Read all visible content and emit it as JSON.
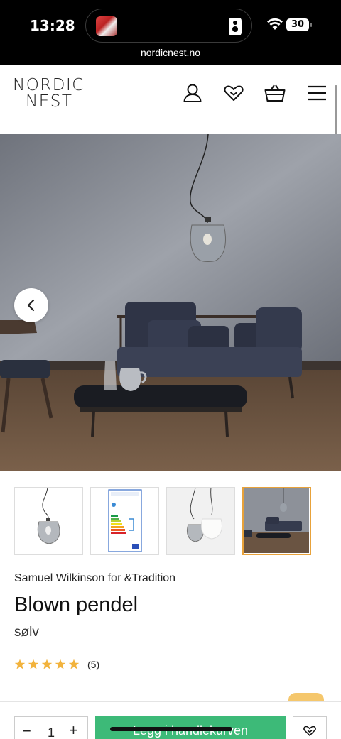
{
  "status_bar": {
    "time": "13:28",
    "battery": "30",
    "url": "nordicnest.no"
  },
  "header": {
    "logo_line1": "NORDIC",
    "logo_line2": "NEST",
    "icons": [
      "account-icon",
      "wishlist-heart-icon",
      "cart-basket-icon",
      "menu-icon"
    ]
  },
  "gallery": {
    "thumbnails": [
      {
        "name": "thumb-lamp",
        "active": false
      },
      {
        "name": "thumb-energy-label",
        "active": false
      },
      {
        "name": "thumb-lamp-pair",
        "active": false
      },
      {
        "name": "thumb-room",
        "active": true
      }
    ],
    "active_color": "#e8a23a"
  },
  "product": {
    "designer": "Samuel Wilkinson",
    "for_word": "for",
    "brand": "&Tradition",
    "title": "Blown pendel",
    "variant": "sølv",
    "rating_stars": 5,
    "rating_count": "(5)",
    "star_color": "#f2b33d"
  },
  "purchase": {
    "quantity": "1",
    "minus": "−",
    "plus": "+",
    "add_to_cart_label": "Legg i handlekurven",
    "button_color": "#3dba78"
  }
}
